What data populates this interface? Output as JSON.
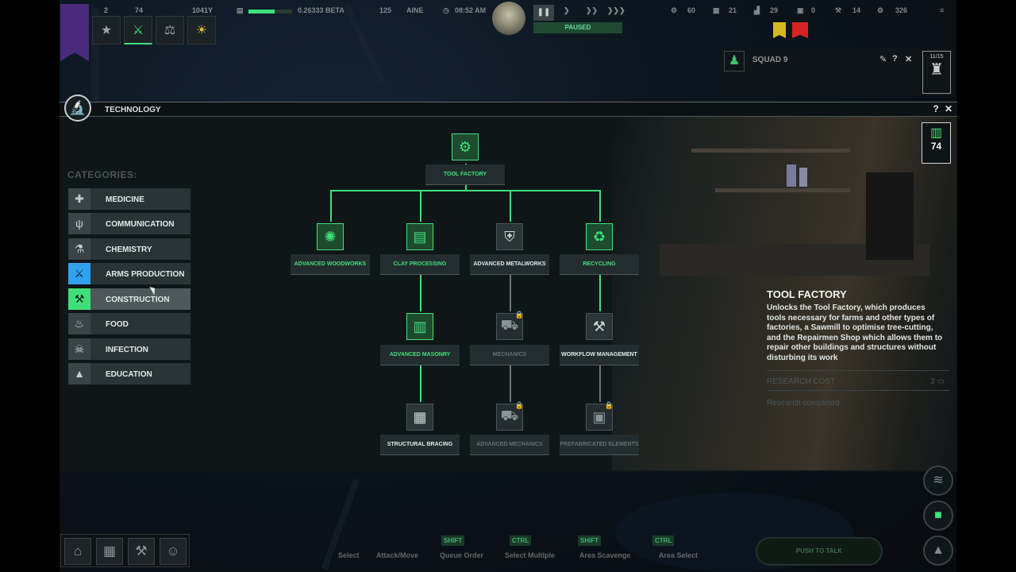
{
  "hud": {
    "skill_counts": [
      "2",
      "74",
      "",
      "1041Y"
    ],
    "population": "0.26333 BETA",
    "time": "08:52 AM",
    "date": "125",
    "weekday": "AINE",
    "paused_label": "PAUSED",
    "resources": [
      "60",
      "21",
      "29",
      "0",
      "14",
      "326"
    ],
    "squad_label": "SQUAD 9",
    "squad_count": "11/15"
  },
  "panel": {
    "title": "TECHNOLOGY",
    "help": "?",
    "close": "✕"
  },
  "categories": {
    "title": "CATEGORIES:",
    "items": [
      {
        "label": "MEDICINE",
        "icon": "medkit-icon",
        "glyph": "✚"
      },
      {
        "label": "COMMUNICATION",
        "icon": "antenna-icon",
        "glyph": "📡"
      },
      {
        "label": "CHEMISTRY",
        "icon": "chemistry-icon",
        "glyph": "⚗"
      },
      {
        "label": "ARMS PRODUCTION",
        "icon": "rifle-icon",
        "glyph": "✈"
      },
      {
        "label": "CONSTRUCTION",
        "icon": "hammer-wrench-icon",
        "glyph": "⚒"
      },
      {
        "label": "FOOD",
        "icon": "food-bowl-icon",
        "glyph": "♨"
      },
      {
        "label": "INFECTION",
        "icon": "skull-icon",
        "glyph": "☠"
      },
      {
        "label": "EDUCATION",
        "icon": "graduation-cap-icon",
        "glyph": "🎓"
      }
    ]
  },
  "tree": {
    "root": {
      "label": "TOOL FACTORY",
      "icon": "tool-factory-icon",
      "glyph": "⚙"
    },
    "tier1": [
      {
        "label": "ADVANCED WOODWORKS",
        "icon": "saw-blade-icon",
        "glyph": "✺"
      },
      {
        "label": "CLAY PROCESSING",
        "icon": "brick-icon",
        "glyph": "▤"
      },
      {
        "label": "ADVANCED METALWORKS",
        "icon": "shield-icon",
        "glyph": "⛨"
      },
      {
        "label": "RECYCLING",
        "icon": "recycle-icon",
        "glyph": "♻"
      }
    ],
    "tier2": [
      {
        "label": "ADVANCED MASONRY",
        "icon": "masonry-icon",
        "glyph": "▥"
      },
      {
        "label": "MECHANICS",
        "icon": "mechanics-icon",
        "glyph": "⛟"
      },
      {
        "label": "WORKFLOW MANAGEMENT",
        "icon": "crossed-hammers-icon",
        "glyph": "⚒"
      }
    ],
    "tier3": [
      {
        "label": "STRUCTURAL BRACING",
        "icon": "bracing-icon",
        "glyph": "▦"
      },
      {
        "label": "ADVANCED MECHANICS",
        "icon": "advanced-mechanics-icon",
        "glyph": "⛟"
      },
      {
        "label": "PREFABRICATED ELEMENTS",
        "icon": "prefab-icon",
        "glyph": "▣"
      }
    ]
  },
  "detail": {
    "points": "74",
    "title": "TOOL FACTORY",
    "description": "Unlocks the Tool Factory, which produces tools necessary for farms and other types of factories, a Sawmill to optimise tree-cutting, and the Repairmen Shop which allows them to repair other buildings and structures without disturbing its work",
    "cost_label": "RESEARCH COST",
    "cost_value": "3",
    "status": "Research completed"
  },
  "controls": {
    "keys": [
      "SHIFT",
      "CTRL",
      "SHIFT",
      "CTRL"
    ],
    "actions": [
      "Select",
      "Attack/Move",
      "Queue Order",
      "Select Multiple",
      "Area Scavenge",
      "Area Select"
    ],
    "push_to_talk": "PUSH TO TALK"
  },
  "colors": {
    "accent": "#3fe07a",
    "arms": "#2fa2f0",
    "banner": "#4a2a7c"
  }
}
